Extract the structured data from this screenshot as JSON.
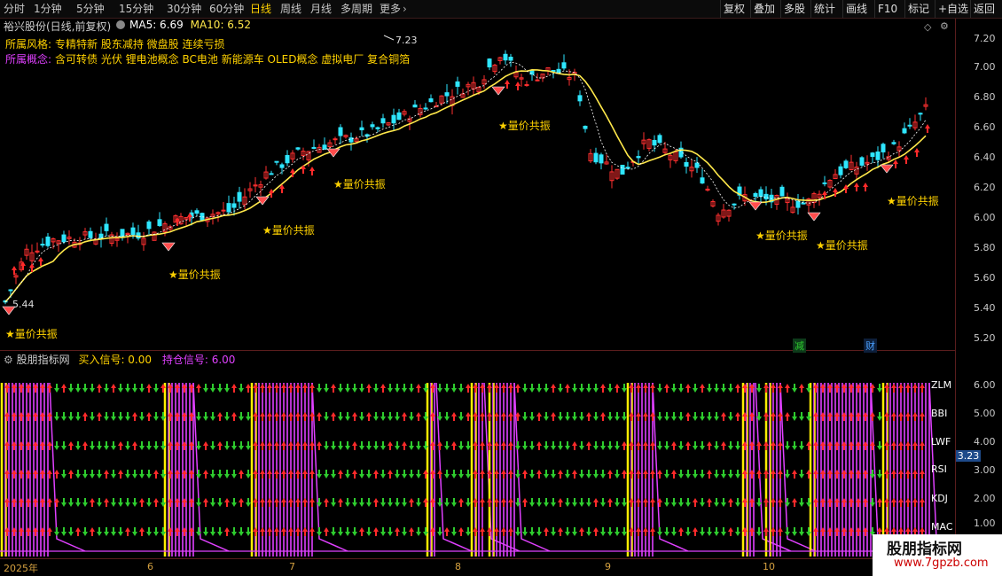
{
  "toolbar": {
    "tabs": [
      "分时",
      "1分钟",
      "5分钟",
      "15分钟",
      "30分钟",
      "60分钟",
      "日线",
      "周线",
      "月线",
      "多周期",
      "更多"
    ],
    "active_tab": "日线",
    "right_buttons": [
      "复权",
      "叠加",
      "多股",
      "统计",
      "画线",
      "F10",
      "标记",
      "+自选",
      "返回"
    ]
  },
  "stock": {
    "title": "裕兴股份(日线,前复权)",
    "ma5_label": "MA5: 6.69",
    "ma10_label": "MA10: 6.52",
    "style_key": "所属风格:",
    "style_value": "专精特新 股东减持 微盘股 连续亏损",
    "concept_key": "所属概念:",
    "concept_value": "含可转债 光伏 锂电池概念 BC电池 新能源车 OLED概念 虚拟电厂 复合铜箔",
    "high_label": "7.23",
    "low_label": "5.44",
    "marker_text": "★量价共振",
    "event_jian": "减",
    "event_cai": "财"
  },
  "price_axis": [
    "7.20",
    "7.00",
    "6.80",
    "6.60",
    "6.40",
    "6.20",
    "6.00",
    "5.80",
    "5.60",
    "5.40",
    "5.20"
  ],
  "indicator": {
    "name": "股朋指标网",
    "buy_label": "买入信号: 0.00",
    "hold_label": "持仓信号: 6.00",
    "rows": [
      "ZLM",
      "BBI",
      "LWF",
      "RSI",
      "KDJ",
      "MAC"
    ],
    "axis": [
      "6.00",
      "5.00",
      "4.00",
      "3.00",
      "2.00",
      "1.00"
    ],
    "cursor_value": "3.23"
  },
  "x_axis": [
    "2025年",
    "6",
    "7",
    "8",
    "9",
    "10"
  ],
  "watermark": {
    "line1": "股朋指标网",
    "line2": "www.7gpzb.com"
  },
  "colors": {
    "up": "#ff3030",
    "down": "#2ee6ff",
    "ma5": "#ffffff",
    "ma10": "#ffe84a",
    "accent": "#ffd200",
    "hold": "#e040ff",
    "green_arrow": "#2ecc2e"
  }
}
